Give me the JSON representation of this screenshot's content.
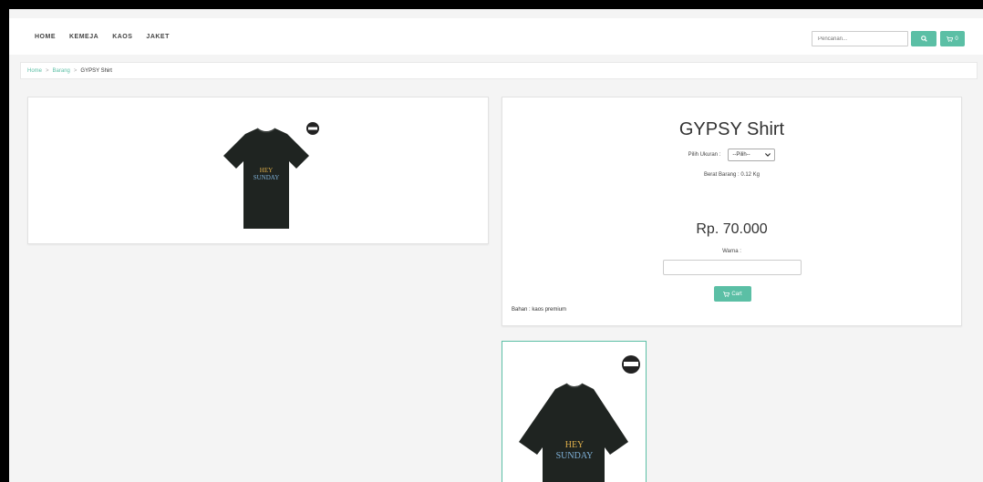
{
  "nav": {
    "items": [
      "HOME",
      "KEMEJA",
      "KAOS",
      "JAKET"
    ],
    "search_placeholder": "Pencarian...",
    "cart_count": "0"
  },
  "breadcrumb": {
    "items": [
      "Home",
      "Barang"
    ],
    "current": "GYPSY Shirt",
    "separator": ">"
  },
  "product": {
    "title": "GYPSY Shirt",
    "size_label": "Pilih Ukuran :",
    "size_selected": "--Pilih--",
    "weight": "Berat Barang : 0.12 Kg",
    "price": "Rp. 70.000",
    "color_label": "Warna :",
    "cart_label": "Cart",
    "material": "Bahan : kaos premium",
    "shirt_text_line1": "HEY",
    "shirt_text_line2": "SUNDAY"
  },
  "colors": {
    "accent": "#5bbfa5",
    "shirt": "#1f2421"
  }
}
